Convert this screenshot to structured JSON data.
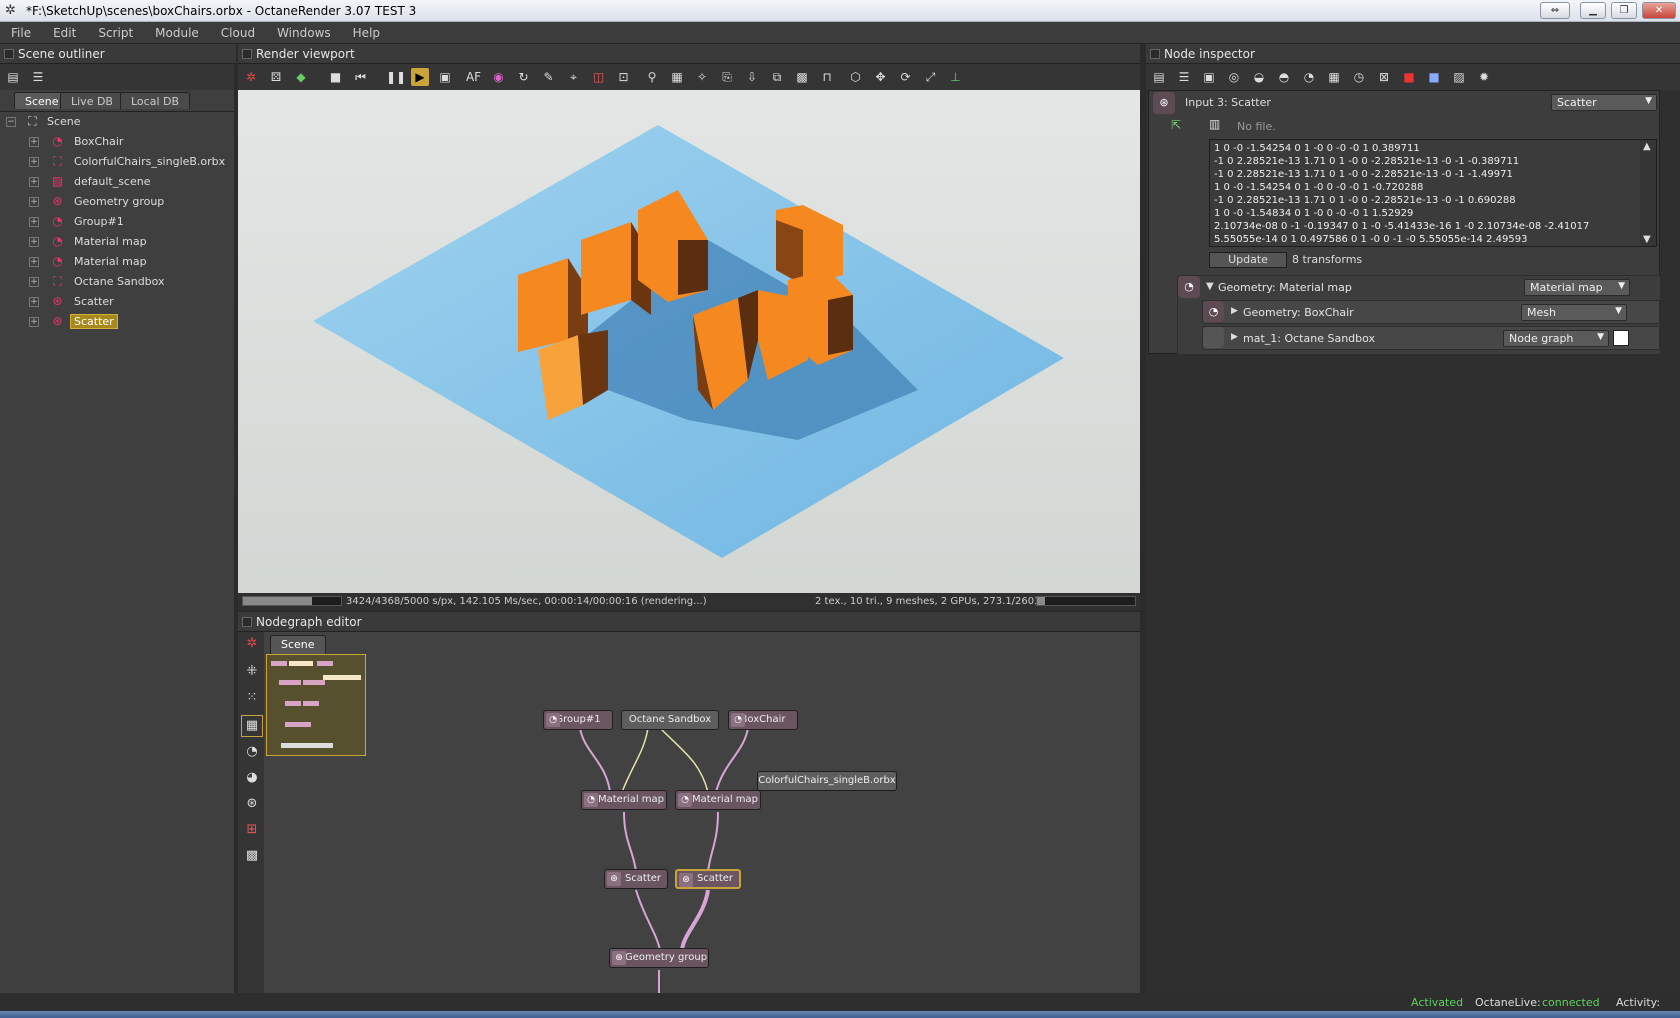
{
  "window": {
    "title": "*F:\\SketchUp\\scenes\\boxChairs.orbx - OctaneRender 3.07 TEST 3"
  },
  "menu": [
    "File",
    "Edit",
    "Script",
    "Module",
    "Cloud",
    "Windows",
    "Help"
  ],
  "outliner": {
    "title": "Scene outliner",
    "tabs": [
      "Scene",
      "Live DB",
      "Local DB"
    ],
    "root": "Scene",
    "items": [
      {
        "label": "BoxChair",
        "icon": "mesh-icon"
      },
      {
        "label": "ColorfulChairs_singleB.orbx",
        "icon": "graph-icon"
      },
      {
        "label": "default_scene",
        "icon": "image-icon"
      },
      {
        "label": "Geometry group",
        "icon": "geometry-icon"
      },
      {
        "label": "Group#1",
        "icon": "mesh-icon"
      },
      {
        "label": "Material map",
        "icon": "mesh-icon"
      },
      {
        "label": "Material map",
        "icon": "mesh-icon"
      },
      {
        "label": "Octane Sandbox",
        "icon": "graph-icon"
      },
      {
        "label": "Scatter",
        "icon": "scatter-icon"
      },
      {
        "label": "Scatter",
        "icon": "scatter-icon",
        "selected": true
      }
    ]
  },
  "viewport": {
    "title": "Render viewport",
    "status_left": "3424/4368/5000 s/px, 142.105 Ms/sec, 00:00:14/00:00:16 (rendering...)",
    "status_right": "2 tex., 10 tri., 9 meshes, 2 GPUs, 273.1/2603/3072 MB",
    "progress": 0.7
  },
  "nodegraph": {
    "title": "Nodegraph editor",
    "tab": "Scene",
    "nodes": {
      "group1": "Group#1",
      "sandbox": "Octane Sandbox",
      "boxchair": "BoxChair",
      "colorful": "ColorfulChairs_singleB.orbx",
      "matmap1": "Material map",
      "matmap2": "Material map",
      "scatter1": "Scatter",
      "scatter2": "Scatter",
      "geogroup": "Geometry group"
    }
  },
  "inspector": {
    "title": "Node inspector",
    "header_label": "Input 3: Scatter",
    "header_type": "Scatter",
    "file": "No file.",
    "transforms": [
      "1 0 -0 -1.54254 0 1 -0 0 -0 -0 1 0.389711",
      "-1 0 2.28521e-13 1.71 0 1 -0 0 -2.28521e-13 -0 -1 -0.389711",
      "-1 0 2.28521e-13 1.71 0 1 -0 0 -2.28521e-13 -0 -1 -1.49971",
      "1 0 -0 -1.54254 0 1 -0 0 -0 -0 1 -0.720288",
      "-1 0 2.28521e-13 1.71 0 1 -0 0 -2.28521e-13 -0 -1 0.690288",
      "1 0 -0 -1.54834 0 1 -0 0 -0 -0 1 1.52929",
      "2.10734e-08 0 -1 -0.19347 0 1 -0 -5.41433e-16 1 -0 2.10734e-08 -2.41017",
      "5.55055e-14 0 1 0.497586 0 1 -0 0 -1 -0 5.55055e-14 2.49593"
    ],
    "update_label": "Update",
    "transform_count": "8 transforms",
    "geo_label": "Geometry: Material map",
    "geo_type": "Material map",
    "sub1_label": "Geometry: BoxChair",
    "sub1_type": "Mesh",
    "sub2_label": "mat_1: Octane Sandbox",
    "sub2_type": "Node graph"
  },
  "status": {
    "activated": "Activated",
    "live_label": "OctaneLive:",
    "live_value": "connected",
    "activity": "Activity:"
  },
  "colors": {
    "accent_selected": "#a8881c",
    "connected": "#5fd35f",
    "node": "#6b5560"
  }
}
